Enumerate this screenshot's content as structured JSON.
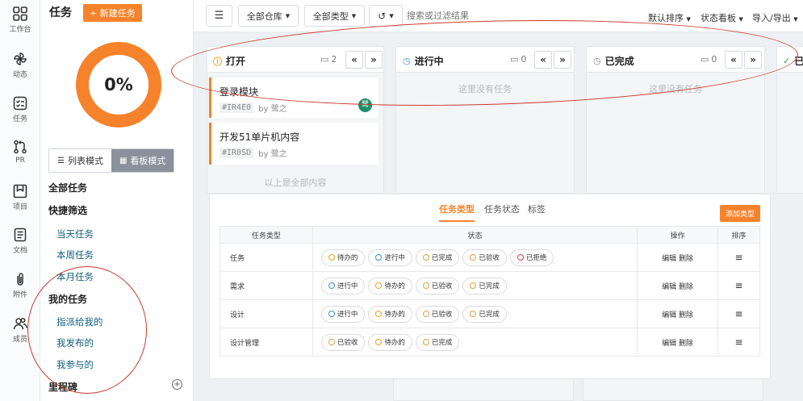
{
  "rail": [
    {
      "key": "workbench",
      "label": "工作台",
      "icon": "grid-icon"
    },
    {
      "key": "activity",
      "label": "动态",
      "icon": "pinwheel-icon"
    },
    {
      "key": "tasks",
      "label": "任务",
      "icon": "checklist-icon"
    },
    {
      "key": "pr",
      "label": "PR",
      "icon": "pull-request-icon"
    },
    {
      "key": "projects",
      "label": "项目",
      "icon": "board-icon"
    },
    {
      "key": "docs",
      "label": "文档",
      "icon": "document-icon"
    },
    {
      "key": "attachments",
      "label": "附件",
      "icon": "paperclip-icon"
    },
    {
      "key": "members",
      "label": "成员",
      "icon": "members-icon"
    }
  ],
  "sidebar": {
    "title": "任务",
    "new_task": "+ 新建任务",
    "progress": "0%",
    "progress_value": 0,
    "mode_list": "列表模式",
    "mode_board": "看板模式",
    "all_tasks": "全部任务",
    "quick_filter": "快捷筛选",
    "filters": [
      "当天任务",
      "本周任务",
      "本月任务"
    ],
    "my_tasks": "我的任务",
    "my_items": [
      "指派给我的",
      "我发布的",
      "我参与的"
    ],
    "milestones": "里程碑"
  },
  "toolbar": {
    "repo": "全部仓库",
    "type": "全部类型",
    "search_placeholder": "搜索或过滤结果",
    "sort": "默认排序",
    "view": "状态看板",
    "io": "导入/导出"
  },
  "columns": [
    {
      "key": "open",
      "title": "打开",
      "count": "2",
      "empty": ""
    },
    {
      "key": "progress",
      "title": "进行中",
      "count": "0",
      "empty": "这里没有任务"
    },
    {
      "key": "done",
      "title": "已完成",
      "count": "0",
      "empty": "这里没有任务"
    },
    {
      "key": "accepted",
      "title": "已",
      "count": "",
      "empty": ""
    }
  ],
  "cards": [
    {
      "title": "登录模块",
      "code": "#IR4E0",
      "by": "by 鹭之",
      "avatar": "鹭"
    },
    {
      "title": "开发51单片机内容",
      "code": "#IR0SD",
      "by": "by 鹭之",
      "avatar": ""
    }
  ],
  "list_end": "以上是全部内容",
  "panel": {
    "tabs": [
      "任务类型",
      "任务状态",
      "标签"
    ],
    "add_button": "添加类型",
    "headers": [
      "任务类型",
      "状态",
      "操作",
      "排序"
    ],
    "rows": [
      {
        "name": "任务",
        "statuses": [
          "待办的",
          "进行中",
          "已完成",
          "已验收",
          "已拒绝"
        ]
      },
      {
        "name": "需求",
        "statuses": [
          "进行中",
          "待办的",
          "已验收",
          "已完成"
        ]
      },
      {
        "name": "设计",
        "statuses": [
          "进行中",
          "待办的",
          "已验收",
          "已完成"
        ]
      },
      {
        "name": "设计管理",
        "statuses": [
          "已验收",
          "待办的",
          "已完成"
        ]
      }
    ],
    "op_edit": "编辑",
    "op_delete": "删除",
    "sort_glyph": "≡"
  },
  "status_colors": {
    "待办的": "#f0a020",
    "进行中": "#3b8fd9",
    "已完成": "#e8a030",
    "已验收": "#e89a40",
    "已拒绝": "#d9453c"
  },
  "colors": {
    "accent": "#f6832b",
    "link": "#0f5f7a",
    "annotation": "#c83a2c"
  }
}
